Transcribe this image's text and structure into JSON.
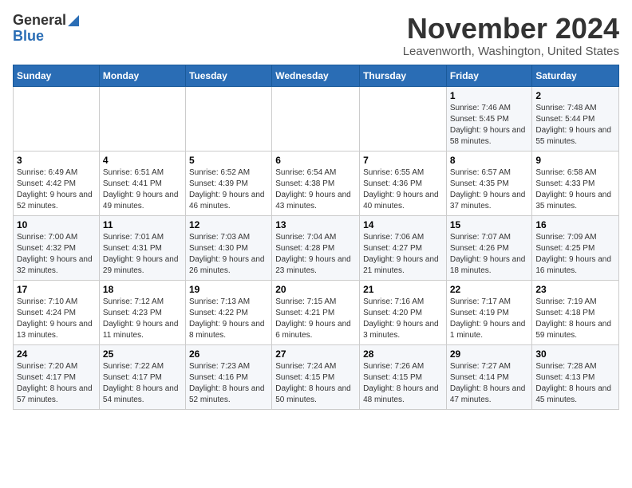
{
  "header": {
    "logo_line1": "General",
    "logo_line2": "Blue",
    "month": "November 2024",
    "location": "Leavenworth, Washington, United States"
  },
  "days_of_week": [
    "Sunday",
    "Monday",
    "Tuesday",
    "Wednesday",
    "Thursday",
    "Friday",
    "Saturday"
  ],
  "weeks": [
    [
      {
        "day": "",
        "info": ""
      },
      {
        "day": "",
        "info": ""
      },
      {
        "day": "",
        "info": ""
      },
      {
        "day": "",
        "info": ""
      },
      {
        "day": "",
        "info": ""
      },
      {
        "day": "1",
        "info": "Sunrise: 7:46 AM\nSunset: 5:45 PM\nDaylight: 9 hours and 58 minutes."
      },
      {
        "day": "2",
        "info": "Sunrise: 7:48 AM\nSunset: 5:44 PM\nDaylight: 9 hours and 55 minutes."
      }
    ],
    [
      {
        "day": "3",
        "info": "Sunrise: 6:49 AM\nSunset: 4:42 PM\nDaylight: 9 hours and 52 minutes."
      },
      {
        "day": "4",
        "info": "Sunrise: 6:51 AM\nSunset: 4:41 PM\nDaylight: 9 hours and 49 minutes."
      },
      {
        "day": "5",
        "info": "Sunrise: 6:52 AM\nSunset: 4:39 PM\nDaylight: 9 hours and 46 minutes."
      },
      {
        "day": "6",
        "info": "Sunrise: 6:54 AM\nSunset: 4:38 PM\nDaylight: 9 hours and 43 minutes."
      },
      {
        "day": "7",
        "info": "Sunrise: 6:55 AM\nSunset: 4:36 PM\nDaylight: 9 hours and 40 minutes."
      },
      {
        "day": "8",
        "info": "Sunrise: 6:57 AM\nSunset: 4:35 PM\nDaylight: 9 hours and 37 minutes."
      },
      {
        "day": "9",
        "info": "Sunrise: 6:58 AM\nSunset: 4:33 PM\nDaylight: 9 hours and 35 minutes."
      }
    ],
    [
      {
        "day": "10",
        "info": "Sunrise: 7:00 AM\nSunset: 4:32 PM\nDaylight: 9 hours and 32 minutes."
      },
      {
        "day": "11",
        "info": "Sunrise: 7:01 AM\nSunset: 4:31 PM\nDaylight: 9 hours and 29 minutes."
      },
      {
        "day": "12",
        "info": "Sunrise: 7:03 AM\nSunset: 4:30 PM\nDaylight: 9 hours and 26 minutes."
      },
      {
        "day": "13",
        "info": "Sunrise: 7:04 AM\nSunset: 4:28 PM\nDaylight: 9 hours and 23 minutes."
      },
      {
        "day": "14",
        "info": "Sunrise: 7:06 AM\nSunset: 4:27 PM\nDaylight: 9 hours and 21 minutes."
      },
      {
        "day": "15",
        "info": "Sunrise: 7:07 AM\nSunset: 4:26 PM\nDaylight: 9 hours and 18 minutes."
      },
      {
        "day": "16",
        "info": "Sunrise: 7:09 AM\nSunset: 4:25 PM\nDaylight: 9 hours and 16 minutes."
      }
    ],
    [
      {
        "day": "17",
        "info": "Sunrise: 7:10 AM\nSunset: 4:24 PM\nDaylight: 9 hours and 13 minutes."
      },
      {
        "day": "18",
        "info": "Sunrise: 7:12 AM\nSunset: 4:23 PM\nDaylight: 9 hours and 11 minutes."
      },
      {
        "day": "19",
        "info": "Sunrise: 7:13 AM\nSunset: 4:22 PM\nDaylight: 9 hours and 8 minutes."
      },
      {
        "day": "20",
        "info": "Sunrise: 7:15 AM\nSunset: 4:21 PM\nDaylight: 9 hours and 6 minutes."
      },
      {
        "day": "21",
        "info": "Sunrise: 7:16 AM\nSunset: 4:20 PM\nDaylight: 9 hours and 3 minutes."
      },
      {
        "day": "22",
        "info": "Sunrise: 7:17 AM\nSunset: 4:19 PM\nDaylight: 9 hours and 1 minute."
      },
      {
        "day": "23",
        "info": "Sunrise: 7:19 AM\nSunset: 4:18 PM\nDaylight: 8 hours and 59 minutes."
      }
    ],
    [
      {
        "day": "24",
        "info": "Sunrise: 7:20 AM\nSunset: 4:17 PM\nDaylight: 8 hours and 57 minutes."
      },
      {
        "day": "25",
        "info": "Sunrise: 7:22 AM\nSunset: 4:17 PM\nDaylight: 8 hours and 54 minutes."
      },
      {
        "day": "26",
        "info": "Sunrise: 7:23 AM\nSunset: 4:16 PM\nDaylight: 8 hours and 52 minutes."
      },
      {
        "day": "27",
        "info": "Sunrise: 7:24 AM\nSunset: 4:15 PM\nDaylight: 8 hours and 50 minutes."
      },
      {
        "day": "28",
        "info": "Sunrise: 7:26 AM\nSunset: 4:15 PM\nDaylight: 8 hours and 48 minutes."
      },
      {
        "day": "29",
        "info": "Sunrise: 7:27 AM\nSunset: 4:14 PM\nDaylight: 8 hours and 47 minutes."
      },
      {
        "day": "30",
        "info": "Sunrise: 7:28 AM\nSunset: 4:13 PM\nDaylight: 8 hours and 45 minutes."
      }
    ]
  ]
}
